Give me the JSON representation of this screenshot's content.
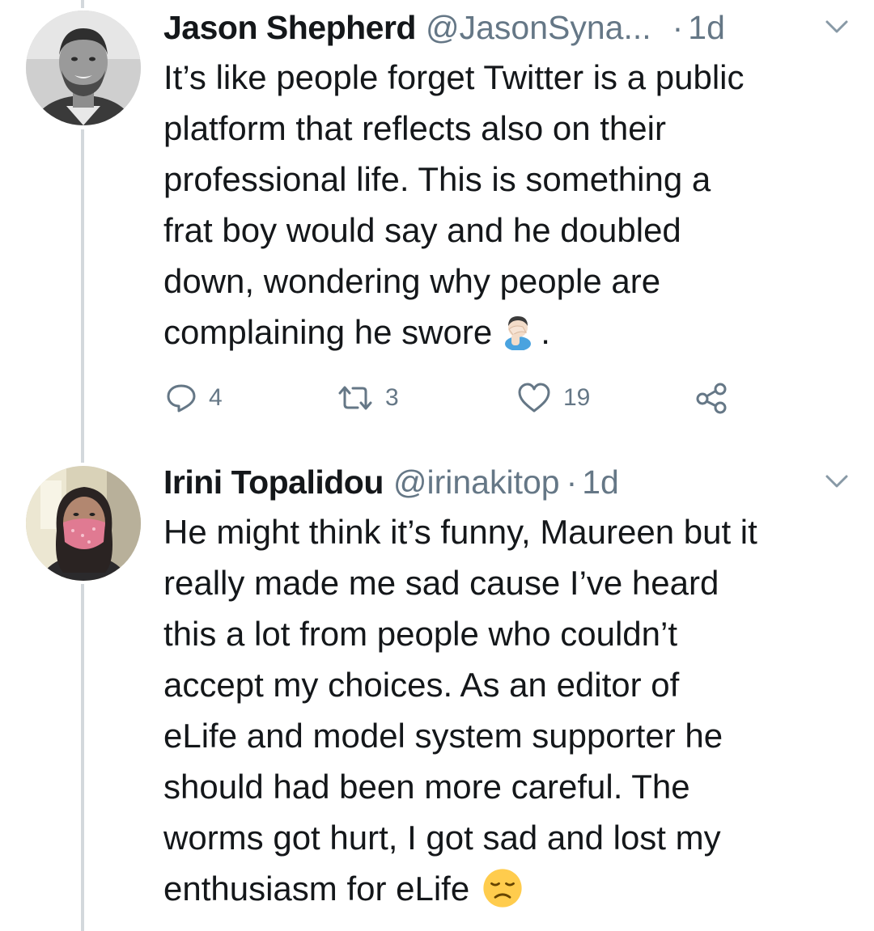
{
  "tweets": [
    {
      "display_name": "Jason Shepherd",
      "handle": "@JasonSyna...",
      "separator": "·",
      "time": "1d",
      "text": "It’s like people forget Twitter is a public\nplatform that reflects also on their\nprofessional life. This is something a\nfrat boy would say and he doubled\ndown, wondering why people are\ncomplaining he swore",
      "text_suffix": ".",
      "emoji_icon": "facepalm-emoji",
      "actions": {
        "reply_count": "4",
        "retweet_count": "3",
        "like_count": "19"
      }
    },
    {
      "display_name": "Irini Topalidou",
      "handle": "@irinakitop",
      "separator": "·",
      "time": "1d",
      "text": "He might think it’s funny, Maureen but it\nreally made me sad cause I’ve heard\nthis a lot from people who couldn’t\naccept my choices. As an editor of\neLife and model system supporter he\nshould had been more careful. The\nworms got hurt, I got sad and lost my\nenthusiasm for eLife",
      "emoji_icon": "disappointed-face-emoji"
    }
  ],
  "colors": {
    "text": "#14171a",
    "secondary": "#657786",
    "thread_line": "#d3d8dc"
  }
}
